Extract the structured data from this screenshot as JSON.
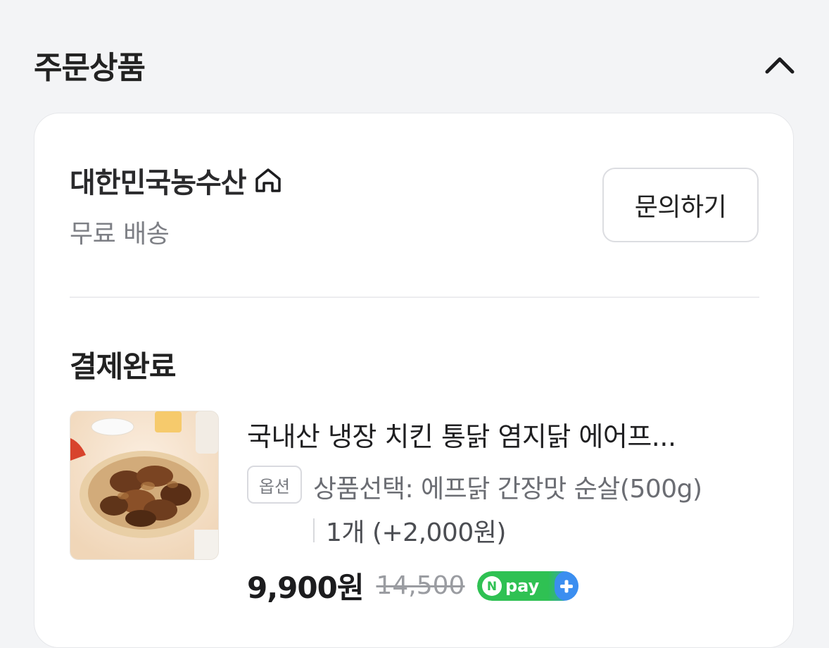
{
  "header": {
    "title": "주문상품"
  },
  "seller": {
    "name": "대한민국농수산",
    "shipping": "무료 배송",
    "inquiry_label": "문의하기"
  },
  "order": {
    "status": "결제완료",
    "product": {
      "name": "국내산 냉장 치킨 통닭 염지닭 에어프...",
      "option_badge": "옵션",
      "option_text": "상품선택: 에프닭 간장맛 순살(500g)",
      "quantity_text": "1개 (+2,000원)",
      "price": "9,900원",
      "original_price": "14,500",
      "payment_badge": "pay"
    }
  },
  "colors": {
    "npay_green": "#2fc153",
    "npay_blue": "#3b8ef0"
  }
}
